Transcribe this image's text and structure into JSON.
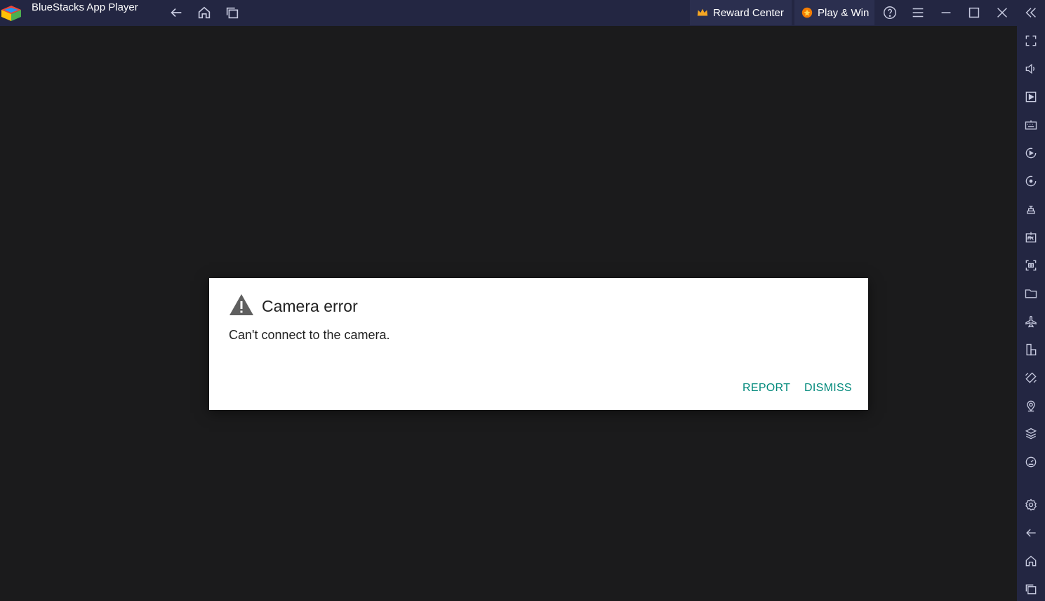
{
  "window": {
    "title": "BlueStacks App Player"
  },
  "titlebar": {
    "nav_icons": [
      "back-icon",
      "home-icon",
      "recent-apps-icon"
    ],
    "reward_center_label": "Reward Center",
    "play_win_label": "Play & Win",
    "controls": [
      "help-icon",
      "menu-icon",
      "minimize-icon",
      "maximize-icon",
      "close-icon",
      "collapse-sidebar-icon"
    ]
  },
  "sidebar": {
    "items": [
      "fullscreen-icon",
      "volume-icon",
      "media-manager-icon",
      "keyboard-controls-icon",
      "macro-recorder-icon",
      "sync-icon",
      "game-controls-icon",
      "install-apk-icon",
      "screenshot-icon",
      "folder-icon",
      "airplane-mode-icon",
      "multi-instance-icon",
      "rotate-icon",
      "location-icon",
      "layers-icon",
      "eco-mode-icon",
      "settings-icon",
      "back-icon",
      "home-icon",
      "recent-apps-icon"
    ]
  },
  "dialog": {
    "icon": "warning-icon",
    "title": "Camera error",
    "message": "Can't connect to the camera.",
    "report_label": "REPORT",
    "dismiss_label": "DISMISS",
    "accent_color": "#00897b"
  },
  "colors": {
    "titlebar_bg": "#232642",
    "screen_bg": "#1b1b1c"
  }
}
